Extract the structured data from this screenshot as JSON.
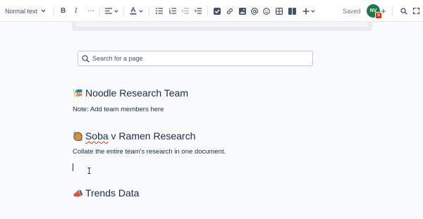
{
  "toolbar": {
    "text_style": "Normal text",
    "bold_label": "B",
    "italic_label": "I",
    "more_label": "···",
    "icons": [
      "chevron-down-icon",
      "align-left-icon",
      "text-color-icon",
      "bullet-list-icon",
      "numbered-list-icon",
      "outdent-icon",
      "indent-icon",
      "task-checkbox-icon",
      "link-icon",
      "image-icon",
      "mention-icon",
      "emoji-icon",
      "table-icon",
      "layout-icon",
      "insert-plus-icon"
    ],
    "saved_label": "Saved",
    "avatar_initials": "NV",
    "avatar_badge": "N",
    "add_collaborator_label": "+"
  },
  "content": {
    "search_placeholder": "Search for a page",
    "sections": [
      {
        "emoji": "🎏",
        "heading": "Noodle Research Team",
        "body": "Note: Add team members here"
      },
      {
        "emoji": "🥘",
        "heading_word_flagged": "Soba",
        "heading_rest": " v Ramen Research",
        "body": "Collate the entire team's research in one document."
      },
      {
        "emoji": "📣",
        "heading": "Trends Data"
      }
    ]
  },
  "colors": {
    "accent": "#0052cc",
    "avatar_bg": "#1f7a4b",
    "badge_bg": "#de350b",
    "text": "#172b4d",
    "icon": "#42526e"
  }
}
